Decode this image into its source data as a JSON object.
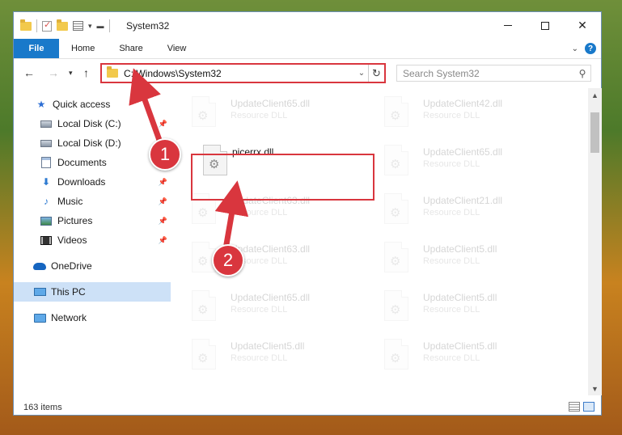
{
  "window": {
    "title": "System32",
    "minimize_icon": "minimize-icon",
    "maximize_icon": "maximize-icon",
    "close_glyph": "✕"
  },
  "ribbon": {
    "tabs": [
      "File",
      "Home",
      "Share",
      "View"
    ],
    "help_glyph": "?"
  },
  "address": {
    "path": "C:\\Windows\\System32",
    "search_placeholder": "Search System32"
  },
  "nav": {
    "items": [
      {
        "label": "Quick access",
        "icon": "star-icon"
      },
      {
        "label": "Local Disk (C:)",
        "icon": "drive-icon",
        "pinned": true
      },
      {
        "label": "Local Disk (D:)",
        "icon": "drive-icon"
      },
      {
        "label": "Documents",
        "icon": "documents-icon",
        "pinned": true
      },
      {
        "label": "Downloads",
        "icon": "download-icon",
        "pinned": true
      },
      {
        "label": "Music",
        "icon": "music-icon",
        "pinned": true
      },
      {
        "label": "Pictures",
        "icon": "pictures-icon",
        "pinned": true
      },
      {
        "label": "Videos",
        "icon": "videos-icon",
        "pinned": true
      },
      {
        "label": "OneDrive",
        "icon": "onedrive-icon"
      },
      {
        "label": "This PC",
        "icon": "computer-icon",
        "selected": true
      },
      {
        "label": "Network",
        "icon": "network-icon"
      }
    ]
  },
  "files": [
    {
      "name": "UpdateClient65.dll",
      "type": "Resource DLL"
    },
    {
      "name": "UpdateClient42.dll",
      "type": "Resource DLL"
    },
    {
      "name": "picerrx.dll",
      "type": "",
      "selected": true
    },
    {
      "name": "UpdateClient65.dll",
      "type": "Resource DLL"
    },
    {
      "name": "UpdateClient63.dll",
      "type": "Resource DLL"
    },
    {
      "name": "UpdateClient21.dll",
      "type": "Resource DLL"
    },
    {
      "name": "UpdateClient63.dll",
      "type": "Resource DLL"
    },
    {
      "name": "UpdateClient5.dll",
      "type": "Resource DLL"
    },
    {
      "name": "UpdateClient65.dll",
      "type": "Resource DLL"
    },
    {
      "name": "UpdateClient5.dll",
      "type": "Resource DLL"
    },
    {
      "name": "UpdateClient5.dll",
      "type": "Resource DLL"
    },
    {
      "name": "UpdateClient5.dll",
      "type": "Resource DLL"
    }
  ],
  "status": {
    "item_count": "163 items"
  },
  "annotations": {
    "step1": "1",
    "step2": "2",
    "color": "#d9363e"
  }
}
